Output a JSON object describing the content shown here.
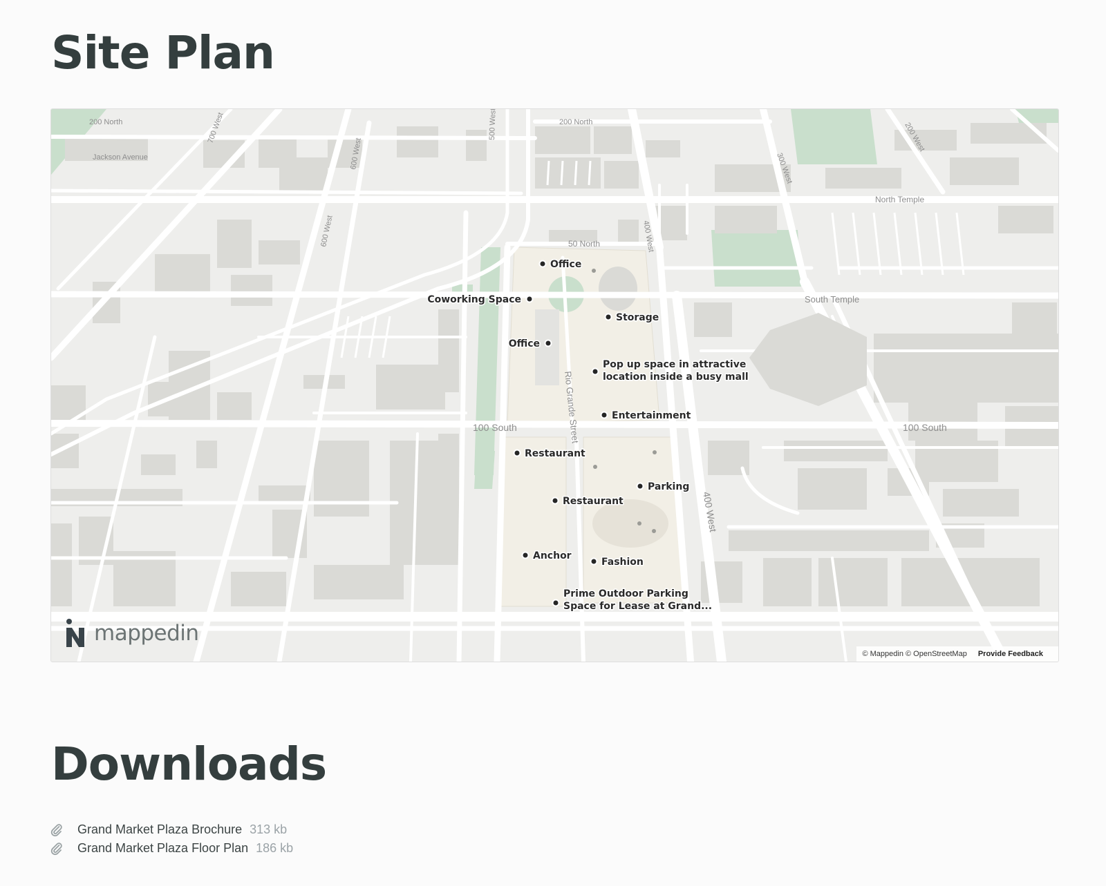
{
  "site_plan": {
    "title": "Site Plan"
  },
  "map": {
    "logo_text": "mappedin",
    "attribution": "© Mappedin © OpenStreetMap",
    "feedback": "Provide Feedback",
    "colors": {
      "ground": "#eeeeec",
      "road": "#ffffff",
      "block": "#dadad6",
      "park": "#c9dfcc",
      "mall": "#f2efe6",
      "poi": "#262626"
    },
    "streets": {
      "s200n_a": "200 North",
      "s200n_b": "200 North",
      "jackson": "Jackson Avenue",
      "w700": "700 West",
      "w600_a": "600 West",
      "w600_b": "600 West",
      "w500": "500 West",
      "w400_a": "400 West",
      "w400_b": "400 West",
      "w300": "300 West",
      "w200": "200 West",
      "n50": "50 North",
      "north_temple": "North Temple",
      "south_temple": "South Temple",
      "s100_a": "100 South",
      "s100_b": "100 South",
      "rio_grande": "Rio Grande Street"
    },
    "pois": {
      "office_1": "Office",
      "coworking": "Coworking Space",
      "storage": "Storage",
      "office_2": "Office",
      "popup_1": "Pop up space in attractive",
      "popup_2": "location inside a busy mall",
      "entertainment": "Entertainment",
      "restaurant_1": "Restaurant",
      "parking": "Parking",
      "restaurant_2": "Restaurant",
      "anchor": "Anchor",
      "fashion": "Fashion",
      "outdoor_1": "Prime Outdoor Parking",
      "outdoor_2": "Space for Lease at Grand..."
    }
  },
  "downloads": {
    "title": "Downloads",
    "icon": "paperclip-icon",
    "items": [
      {
        "name": "Grand Market Plaza Brochure",
        "size": "313 kb"
      },
      {
        "name": "Grand Market Plaza Floor Plan",
        "size": "186 kb"
      }
    ]
  }
}
